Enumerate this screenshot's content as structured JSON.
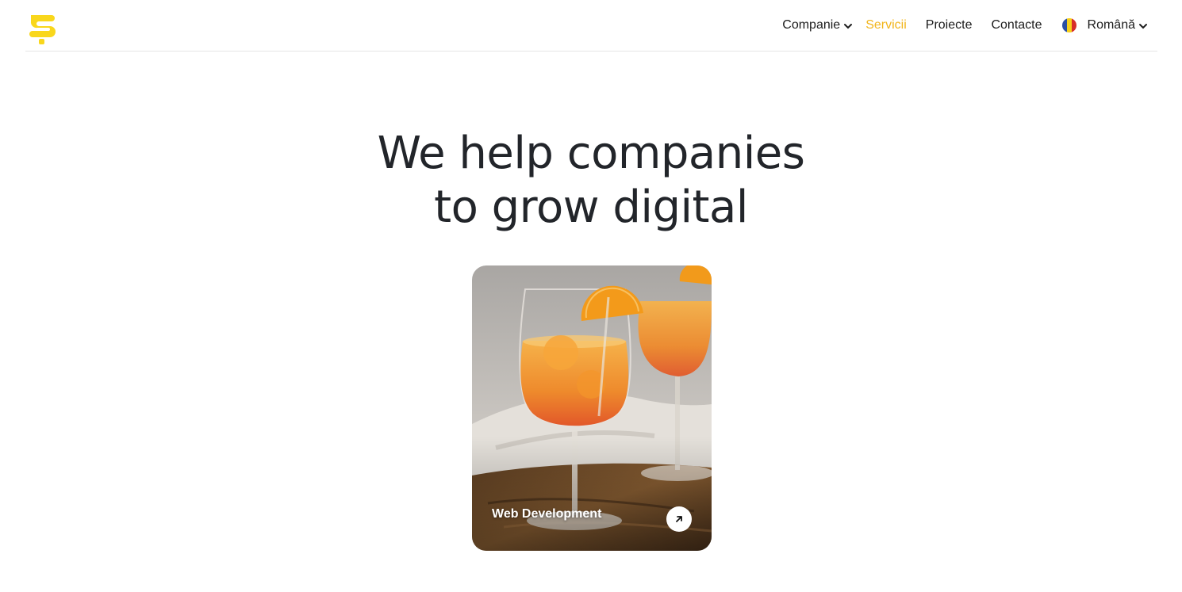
{
  "header": {
    "logo_name": "brand-logo",
    "nav": [
      {
        "label": "Companie",
        "has_dropdown": true,
        "active": false
      },
      {
        "label": "Servicii",
        "has_dropdown": false,
        "active": true
      },
      {
        "label": "Proiecte",
        "has_dropdown": false,
        "active": false
      },
      {
        "label": "Contacte",
        "has_dropdown": false,
        "active": false
      }
    ],
    "language": {
      "label": "Română",
      "flag": "romania-flag-icon",
      "has_dropdown": true
    }
  },
  "hero": {
    "title_line1": "We help companies",
    "title_line2": "to grow digital"
  },
  "service_card": {
    "label": "Web Development",
    "image": "cocktail-glasses-photo",
    "arrow_icon": "arrow-up-right-icon"
  },
  "colors": {
    "brand_yellow": "#f9d71c",
    "active_nav": "#f2b51b",
    "text_dark": "#22252a"
  }
}
